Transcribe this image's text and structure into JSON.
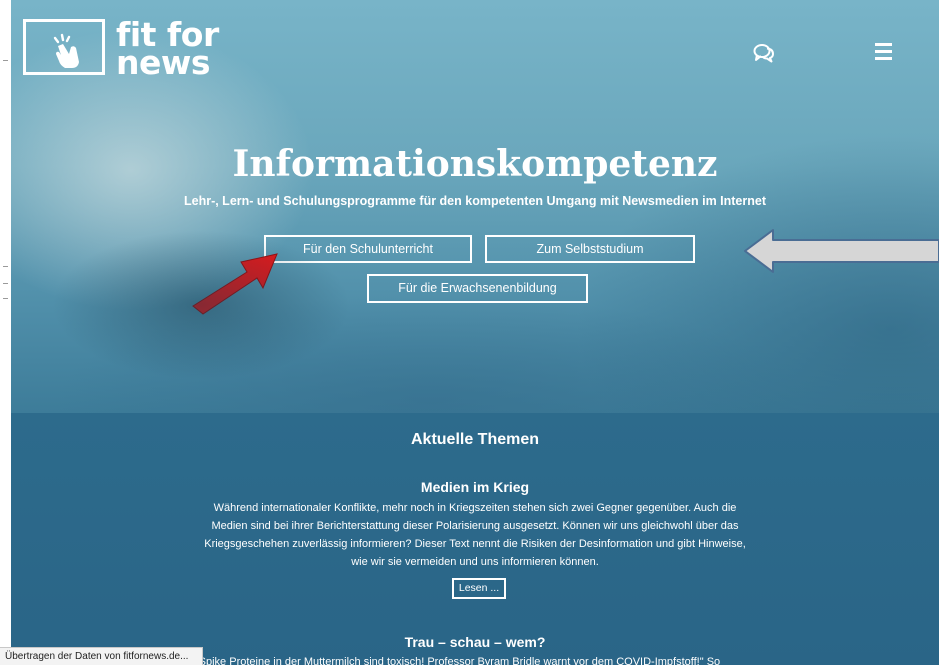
{
  "logo": {
    "line1": "fit for",
    "line2": "news",
    "icon": "pointing-hand-icon"
  },
  "header_icons": {
    "chat": "chat-bubbles-icon",
    "menu": "hamburger-menu-icon"
  },
  "hero": {
    "title": "Informationskompetenz",
    "subtitle": "Lehr-, Lern- und Schulungsprogramme für den kompetenten Umgang mit Newsmedien im Internet",
    "buttons": {
      "school": "Für den Schulunterricht",
      "self_study": "Zum Selbststudium",
      "adult": "Für die Erwachsenenbildung"
    }
  },
  "annotations": {
    "red_arrow_color": "#e3191b",
    "grey_arrow_fill": "#d6d6d6",
    "grey_arrow_stroke": "#4a6d94"
  },
  "topics": {
    "heading": "Aktuelle Themen",
    "articles": [
      {
        "title": "Medien im Krieg",
        "body": "Während internationaler Konflikte, mehr noch in Kriegszeiten stehen sich zwei Gegner gegenüber. Auch die Medien sind bei ihrer Berichterstattung dieser Polarisierung ausgesetzt. Können wir uns gleichwohl über das Kriegsgeschehen zuverlässig informieren? Dieser Text nennt die Risiken der Desinformation und gibt Hinweise, wie wir sie vermeiden und uns informieren können.",
        "button": "Lesen ..."
      },
      {
        "title": "Trau – schau – wem?",
        "body": "„Spike Proteine in der Muttermilch sind toxisch! Professor Byram Bridle warnt vor dem COVID-Impfstoff!\" So"
      }
    ]
  },
  "statusbar": {
    "text": "Übertragen der Daten von fitfornews.de..."
  },
  "colors": {
    "hero_accent": "#6aa7bc",
    "topics_background": "#2d6b8c",
    "text": "#ffffff"
  }
}
